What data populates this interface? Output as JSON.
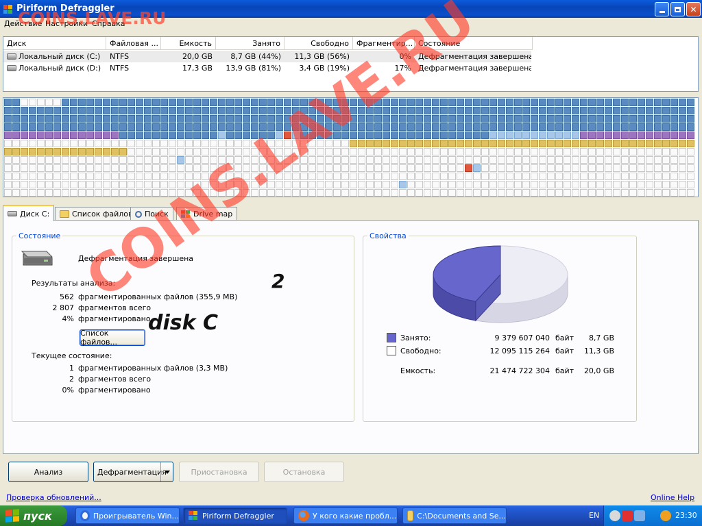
{
  "window": {
    "title": "Piriform Defraggler"
  },
  "watermark": {
    "top": "COINS.LAVE.RU",
    "diagonal": "COINS.LAVE.RU"
  },
  "annotations": {
    "number": "2",
    "disk": "disk C"
  },
  "menu": [
    "Действие",
    "Настройки",
    "Справка"
  ],
  "drive_list": {
    "columns": [
      "Диск",
      "Файловая ...",
      "Емкость",
      "Занято",
      "Свободно",
      "Фрагментир...",
      "Состояние"
    ],
    "rows": [
      [
        "Локальный диск (C:)",
        "NTFS",
        "20,0 GB",
        "8,7 GB (44%)",
        "11,3 GB (56%)",
        "0%",
        "Дефрагментация завершена"
      ],
      [
        "Локальный диск (D:)",
        "NTFS",
        "17,3 GB",
        "13,9 GB (81%)",
        "3,4 GB (19%)",
        "17%",
        "Дефрагментация завершена"
      ]
    ]
  },
  "tabs": [
    "Диск C:",
    "Список файлов",
    "Поиск",
    "Drive map"
  ],
  "status": {
    "legend": "Состояние",
    "message": "Дефрагментация завершена",
    "analysis_title": "Результаты анализа:",
    "analysis": [
      {
        "value": "562",
        "label": "фрагментированных файлов (355,9 MB)"
      },
      {
        "value": "2 807",
        "label": "фрагментов всего"
      },
      {
        "value": "4%",
        "label": "фрагментировано"
      }
    ],
    "file_list_button": "Список файлов...",
    "current_title": "Текущее состояние:",
    "current": [
      {
        "value": "1",
        "label": "фрагментированных файлов (3,3 MB)"
      },
      {
        "value": "2",
        "label": "фрагментов всего"
      },
      {
        "value": "0%",
        "label": "фрагментировано"
      }
    ]
  },
  "properties": {
    "legend": "Свойства",
    "used_fraction": 0.44,
    "used_color": "#6666cc",
    "free_color": "#ededf5",
    "rows": [
      {
        "label": "Занято:",
        "bytes": "9 379 607 040",
        "unit": "байт",
        "size": "8,7 GB"
      },
      {
        "label": "Свободно:",
        "bytes": "12 095 115 264",
        "unit": "байт",
        "size": "11,3 GB"
      },
      {
        "label": "Емкость:",
        "bytes": "21 474 722 304",
        "unit": "байт",
        "size": "20,0 GB"
      }
    ]
  },
  "buttons": {
    "analyze": "Анализ",
    "defrag": "Дефрагментация",
    "pause": "Приостановка",
    "stop": "Остановка"
  },
  "links": {
    "updates": "Проверка обновлений...",
    "help": "Online Help"
  },
  "taskbar": {
    "start": "пуск",
    "tasks": [
      "Проигрыватель Win...",
      "Piriform Defraggler",
      "У кого какие пробл...",
      "C:\\Documents and Se..."
    ],
    "lang": "EN",
    "clock": "23:30"
  }
}
